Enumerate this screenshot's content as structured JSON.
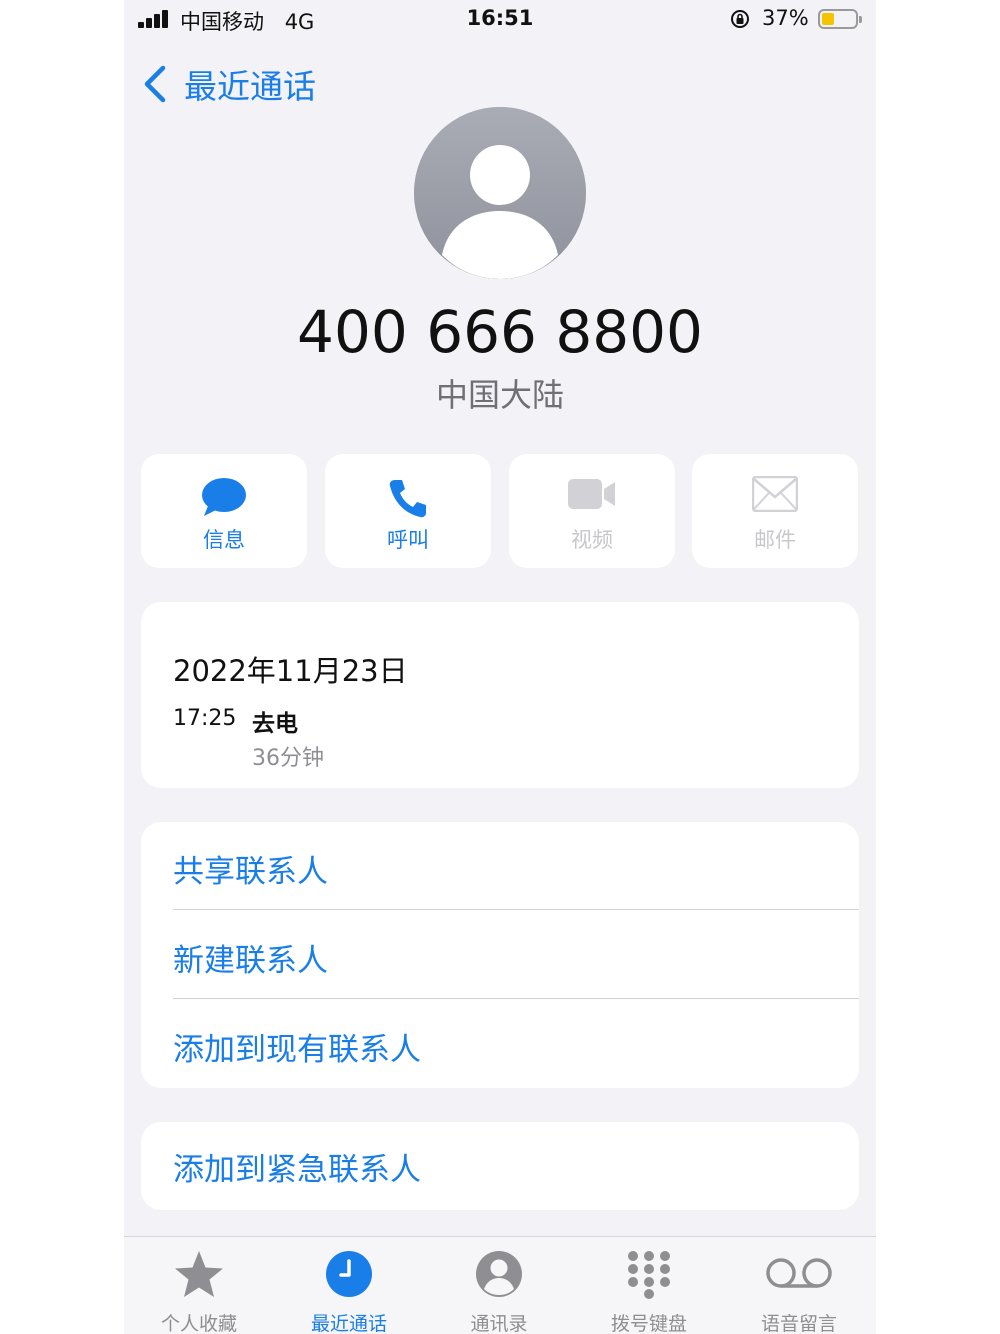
{
  "status_bar": {
    "carrier": "中国移动",
    "network": "4G",
    "time": "16:51",
    "battery_percent": "37%",
    "battery_level": 0.37
  },
  "nav": {
    "back_label": "最近通话"
  },
  "contact": {
    "number": "400 666 8800",
    "region": "中国大陆"
  },
  "actions": [
    {
      "label": "信息",
      "icon": "message-bubble-icon",
      "enabled": true
    },
    {
      "label": "呼叫",
      "icon": "phone-icon",
      "enabled": true
    },
    {
      "label": "视频",
      "icon": "video-camera-icon",
      "enabled": false
    },
    {
      "label": "邮件",
      "icon": "envelope-icon",
      "enabled": false
    }
  ],
  "call_log": {
    "date": "2022年11月23日",
    "entries": [
      {
        "time": "17:25",
        "type": "去电",
        "duration": "36分钟"
      }
    ]
  },
  "options": [
    "共享联系人",
    "新建联系人",
    "添加到现有联系人"
  ],
  "emergency_option": "添加到紧急联系人",
  "tabs": [
    {
      "label": "个人收藏",
      "icon": "star-icon",
      "active": false
    },
    {
      "label": "最近通话",
      "icon": "clock-icon",
      "active": true
    },
    {
      "label": "通讯录",
      "icon": "person-circle-icon",
      "active": false
    },
    {
      "label": "拨号键盘",
      "icon": "keypad-icon",
      "active": false
    },
    {
      "label": "语音留言",
      "icon": "voicemail-icon",
      "active": false
    }
  ],
  "colors": {
    "accent": "#1a7ee8",
    "background": "#f2f2f7",
    "disabled": "#c7c7cc",
    "secondary_text": "#8e8e93"
  }
}
